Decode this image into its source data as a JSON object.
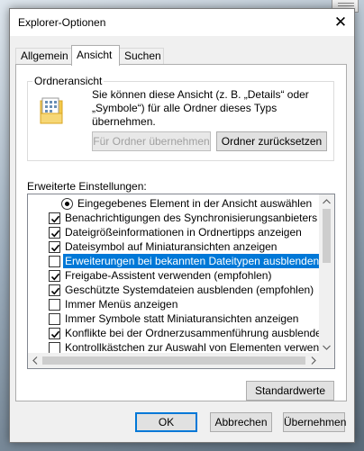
{
  "window": {
    "title": "Explorer-Optionen",
    "close_glyph": "✕"
  },
  "tabs": [
    {
      "label": "Allgemein",
      "active": false
    },
    {
      "label": "Ansicht",
      "active": true
    },
    {
      "label": "Suchen",
      "active": false
    }
  ],
  "folder_view": {
    "title": "Ordneransicht",
    "description": "Sie können diese Ansicht (z. B. „Details“ oder „Symbole“) für alle Ordner dieses Typs übernehmen.",
    "apply_button": "Für Ordner übernehmen",
    "reset_button": "Ordner zurücksetzen"
  },
  "advanced": {
    "label": "Erweiterte Einstellungen:",
    "rows": [
      {
        "type": "radio",
        "checked": true,
        "label": "Eingegebenes Element in der Ansicht auswählen"
      },
      {
        "type": "checkbox",
        "checked": true,
        "label": "Benachrichtigungen des Synchronisierungsanbieters anzeig"
      },
      {
        "type": "checkbox",
        "checked": true,
        "label": "Dateigrößeinformationen in Ordnertipps anzeigen"
      },
      {
        "type": "checkbox",
        "checked": true,
        "label": "Dateisymbol auf Miniaturansichten anzeigen"
      },
      {
        "type": "checkbox",
        "checked": false,
        "selected": true,
        "label": "Erweiterungen bei bekannten Dateitypen ausblenden"
      },
      {
        "type": "checkbox",
        "checked": true,
        "label": "Freigabe-Assistent verwenden (empfohlen)"
      },
      {
        "type": "checkbox",
        "checked": true,
        "label": "Geschützte Systemdateien ausblenden (empfohlen)"
      },
      {
        "type": "checkbox",
        "checked": false,
        "label": "Immer Menüs anzeigen"
      },
      {
        "type": "checkbox",
        "checked": false,
        "label": "Immer Symbole statt Miniaturansichten anzeigen"
      },
      {
        "type": "checkbox",
        "checked": true,
        "label": "Konflikte bei der Ordnerzusammenführung ausblenden"
      },
      {
        "type": "checkbox",
        "checked": false,
        "label": "Kontrollkästchen zur Auswahl von Elementen verwenden"
      }
    ]
  },
  "defaults_button": "Standardwerte",
  "footer": {
    "ok": "OK",
    "cancel": "Abbrechen",
    "apply": "Übernehmen"
  },
  "icons": {
    "close": "close-icon",
    "folder": "folder-options-icon",
    "checkbox_check": "check-icon"
  },
  "colors": {
    "selection": "#0078d7"
  }
}
